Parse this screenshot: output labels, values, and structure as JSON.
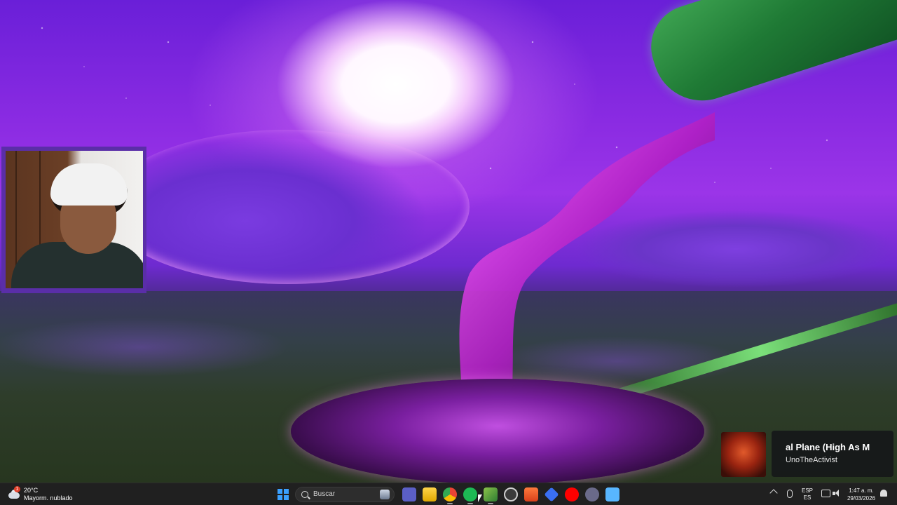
{
  "media": {
    "title": "al Plane (High As M",
    "artist": "UnoTheActivist"
  },
  "weather": {
    "temperature": "20°C",
    "condition": "Mayorm. nublado",
    "badge": "1"
  },
  "taskbar": {
    "search_placeholder": "Buscar",
    "apps": [
      {
        "name": "teams-icon",
        "color": "#5b5fc7"
      },
      {
        "name": "file-explorer-icon",
        "color": "#f2c230"
      },
      {
        "name": "chrome-icon",
        "color": "#34a853"
      },
      {
        "name": "spotify-icon",
        "color": "#1db954"
      },
      {
        "name": "vegas-icon",
        "color": "#8bc34a"
      },
      {
        "name": "obs-icon",
        "color": "#444444"
      },
      {
        "name": "brave-icon",
        "color": "#fb542b"
      },
      {
        "name": "launcher-icon",
        "color": "#3a6ff2"
      },
      {
        "name": "youtube-icon",
        "color": "#ff0000"
      },
      {
        "name": "audio-app-icon",
        "color": "#6a6a8a"
      },
      {
        "name": "notepad-icon",
        "color": "#58b6ff"
      }
    ]
  },
  "tray": {
    "lang_line1": "ESP",
    "lang_line2": "ES",
    "time": "1:47 a. m.",
    "date": "29/03/2026"
  }
}
